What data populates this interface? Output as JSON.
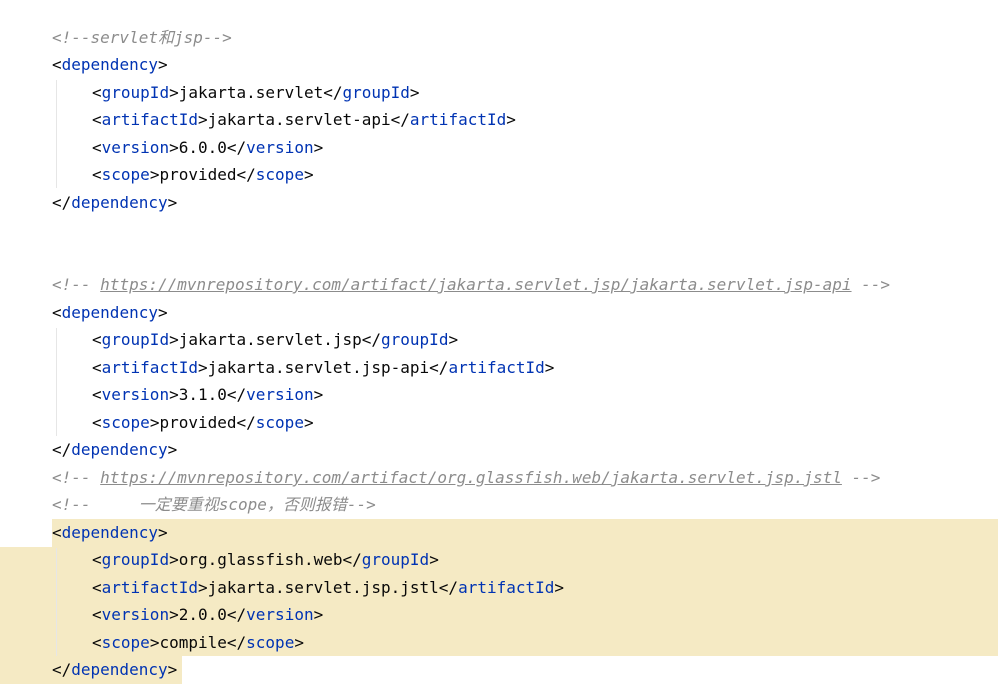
{
  "editor": {
    "comments": {
      "c1": "<!--servlet和jsp-->",
      "c2_open": "<!-- ",
      "c2_url": "https://mvnrepository.com/artifact/jakarta.servlet.jsp/jakarta.servlet.jsp-api",
      "c2_close": " -->",
      "c3_open": "<!-- ",
      "c3_url": "https://mvnrepository.com/artifact/org.glassfish.web/jakarta.servlet.jsp.jstl",
      "c3_close": " -->",
      "c4": "<!--     一定要重视scope，否则报错-->"
    },
    "tags": {
      "dependency": "dependency",
      "groupId": "groupId",
      "artifactId": "artifactId",
      "version": "version",
      "scope": "scope"
    },
    "dep1": {
      "groupId": "jakarta.servlet",
      "artifactId": "jakarta.servlet-api",
      "version": "6.0.0",
      "scope": "provided"
    },
    "dep2": {
      "groupId": "jakarta.servlet.jsp",
      "artifactId": "jakarta.servlet.jsp-api",
      "version": "3.1.0",
      "scope": "provided"
    },
    "dep3": {
      "groupId": "org.glassfish.web",
      "artifactId": "jakarta.servlet.jsp.jstl",
      "version": "2.0.0",
      "scope": "compile"
    },
    "colors": {
      "tag": "#0033b3",
      "text": "#080808",
      "comment": "#8c8c8c",
      "highlight": "#f5eac4"
    }
  }
}
